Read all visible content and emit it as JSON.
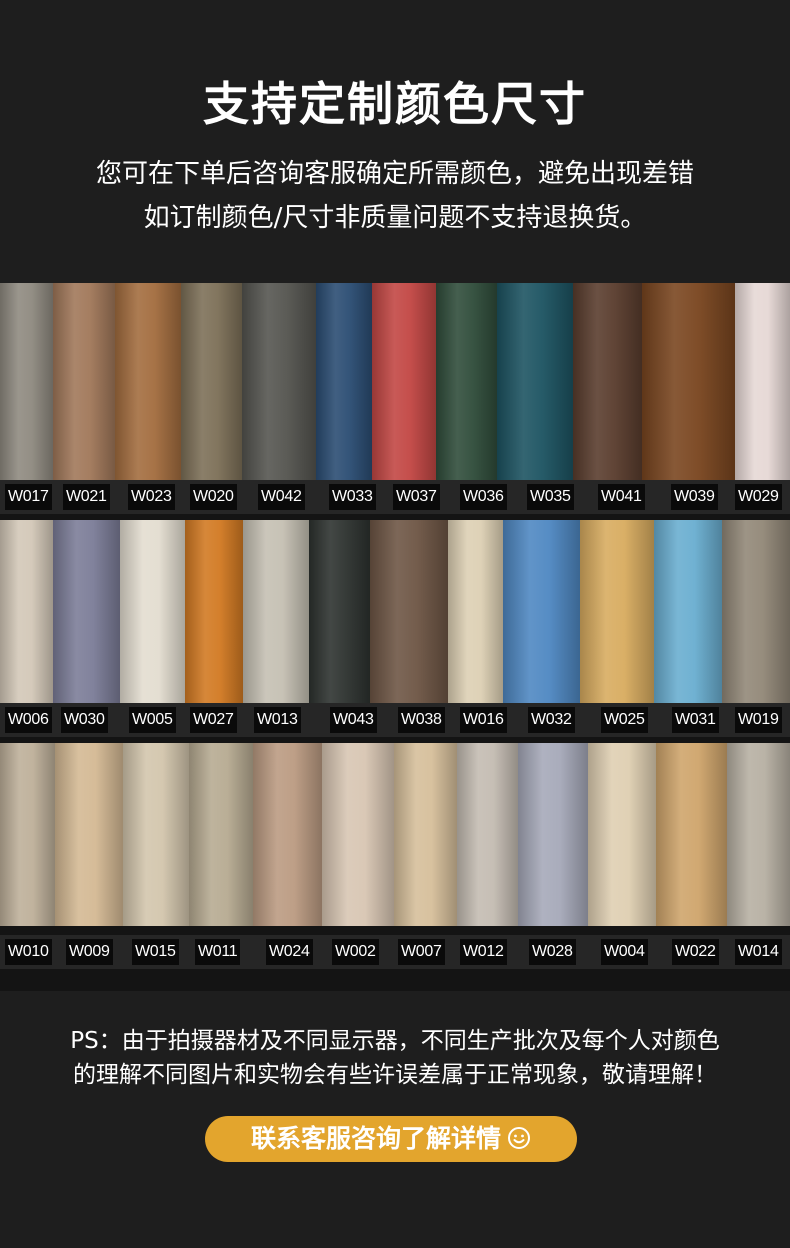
{
  "header": {
    "title": "支持定制颜色尺寸",
    "subtitle_line1": "您可在下单后咨询客服确定所需颜色，避免出现差错",
    "subtitle_line2": "如订制颜色/尺寸非质量问题不支持退换货。"
  },
  "rows": [
    {
      "labels": [
        "W017",
        "W021",
        "W023",
        "W020",
        "W042",
        "W033",
        "W037",
        "W036",
        "W035",
        "W041",
        "W039",
        "W029"
      ],
      "colors": [
        "#8f8a80",
        "#a1785a",
        "#a36d3f",
        "#7d7058",
        "#555550",
        "#2b4d73",
        "#c24744",
        "#304d3b",
        "#1d5462",
        "#5a3d2e",
        "#7a4620",
        "#e6d8d5"
      ]
    },
    {
      "labels": [
        "W006",
        "W030",
        "W005",
        "W027",
        "W013",
        "W043",
        "W038",
        "W016",
        "W032",
        "W025",
        "W031",
        "W019"
      ],
      "colors": [
        "#d3c8b8",
        "#7c7d98",
        "#e3ddd0",
        "#d27a23",
        "#c5c0b3",
        "#2e3330",
        "#6e5645",
        "#ddd0b4",
        "#4f88c2",
        "#d8ac60",
        "#6aaed0",
        "#928878"
      ]
    },
    {
      "labels": [
        "W010",
        "W009",
        "W015",
        "W011",
        "W024",
        "W002",
        "W007",
        "W012",
        "W028",
        "W004",
        "W022",
        "W014"
      ],
      "colors": [
        "#beb09a",
        "#d4b994",
        "#d3c6ad",
        "#b7ab92",
        "#bb9b82",
        "#d8c6b3",
        "#d6bf9b",
        "#c4bcb2",
        "#a6a9b9",
        "#dfcfb2",
        "#cfa56c",
        "#b7b0a3"
      ]
    }
  ],
  "ps_line1": "PS：由于拍摄器材及不同显示器，不同生产批次及每个人对颜色",
  "ps_line2": "的理解不同图片和实物会有些许误差属于正常现象，敬请理解！",
  "cta": {
    "label": "联系客服咨询了解详情",
    "icon": "smile-icon",
    "color": "#e3a52d"
  }
}
